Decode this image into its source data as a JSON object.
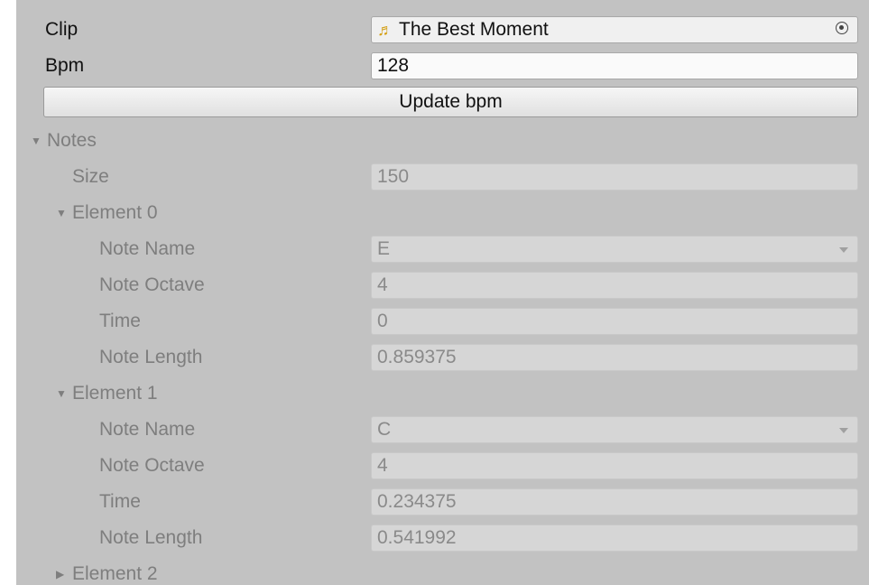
{
  "clip": {
    "label": "Clip",
    "value": "The Best Moment",
    "icon": "music-note-icon"
  },
  "bpm": {
    "label": "Bpm",
    "value": "128"
  },
  "update_button": {
    "label": "Update bpm"
  },
  "notes": {
    "label": "Notes",
    "size_label": "Size",
    "size_value": "150",
    "elements": [
      {
        "label": "Element 0",
        "note_name_label": "Note Name",
        "note_name": "E",
        "note_octave_label": "Note Octave",
        "note_octave": "4",
        "time_label": "Time",
        "time": "0",
        "note_length_label": "Note Length",
        "note_length": "0.859375"
      },
      {
        "label": "Element 1",
        "note_name_label": "Note Name",
        "note_name": "C",
        "note_octave_label": "Note Octave",
        "note_octave": "4",
        "time_label": "Time",
        "time": "0.234375",
        "note_length_label": "Note Length",
        "note_length": "0.541992"
      },
      {
        "label": "Element 2"
      }
    ]
  }
}
